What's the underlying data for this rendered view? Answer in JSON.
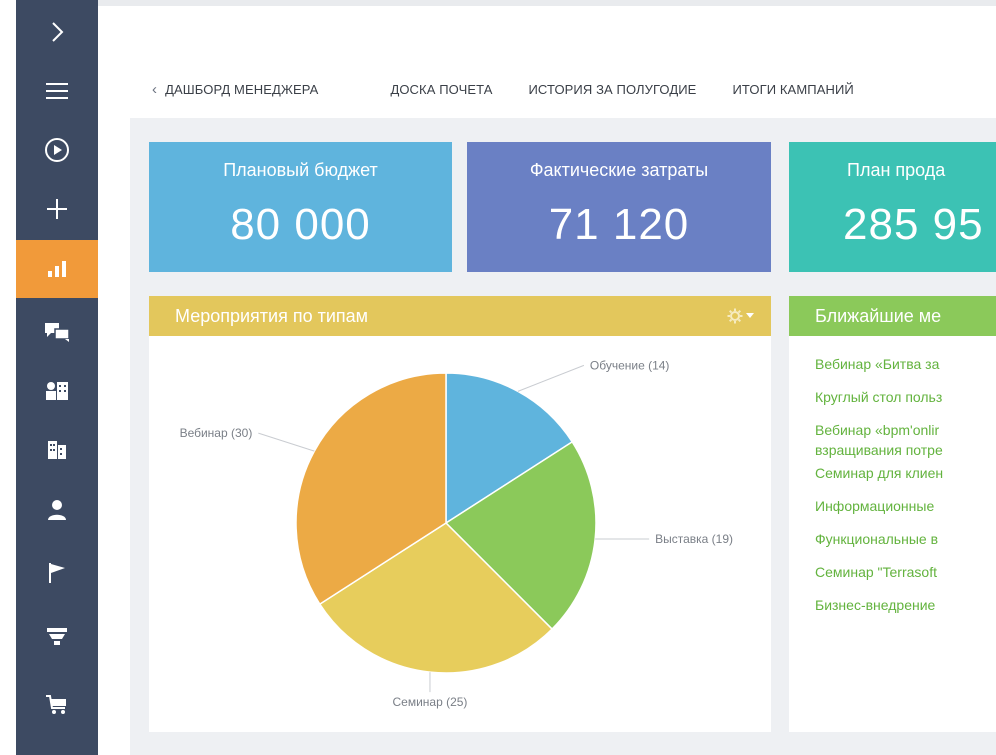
{
  "sidebar": {
    "items": [
      {
        "icon": "chevron-right-icon",
        "active": false
      },
      {
        "icon": "hamburger-menu-icon",
        "active": false
      },
      {
        "icon": "play-circle-icon",
        "active": false
      },
      {
        "icon": "plus-icon",
        "active": false
      },
      {
        "icon": "bar-chart-icon",
        "active": true
      },
      {
        "icon": "chat-bubbles-icon",
        "active": false
      },
      {
        "icon": "contacts-building-icon",
        "active": false
      },
      {
        "icon": "building-icon",
        "active": false
      },
      {
        "icon": "person-icon",
        "active": false
      },
      {
        "icon": "flag-icon",
        "active": false
      },
      {
        "icon": "funnel-icon",
        "active": false
      },
      {
        "icon": "cart-icon",
        "active": false
      }
    ]
  },
  "tabs": {
    "back_label": "ДАШБОРД МЕНЕДЖЕРА",
    "items": [
      "ДОСКА ПОЧЕТА",
      "ИСТОРИЯ ЗА ПОЛУГОДИЕ",
      "ИТОГИ КАМПАНИЙ"
    ]
  },
  "kpis": [
    {
      "title": "Плановый бюджет",
      "value": "80 000",
      "color": "#5fb4dd"
    },
    {
      "title": "Фактические затраты",
      "value": "71 120",
      "color": "#6a80c4"
    },
    {
      "title": "План прода",
      "value": "285 95",
      "color": "#3cc2b4"
    }
  ],
  "events_by_type": {
    "title": "Мероприятия по типам",
    "header_color": "#e3c75c",
    "settings_icon": "gear-icon"
  },
  "chart_data": {
    "type": "pie",
    "categories": [
      "Обучение",
      "Выставка",
      "Семинар",
      "Вебинар"
    ],
    "values": [
      14,
      19,
      25,
      30
    ],
    "labels": [
      "Обучение (14)",
      "Выставка (19)",
      "Семинар (25)",
      "Вебинар (30)"
    ],
    "colors": [
      "#5fb4dd",
      "#8bc95a",
      "#e7cd5c",
      "#ecaa45"
    ]
  },
  "upcoming": {
    "title": "Ближайшие ме",
    "header_color": "#8bc95a",
    "items": [
      {
        "lines": [
          "Вебинар «Битва за"
        ]
      },
      {
        "lines": [
          "Круглый стол польз"
        ]
      },
      {
        "lines": [
          "Вебинар «bpm'onlir",
          "взращивания потре"
        ]
      },
      {
        "lines": [
          "Семинар для клиен"
        ]
      },
      {
        "lines": [
          "Информационные"
        ]
      },
      {
        "lines": [
          "Функциональные в"
        ]
      },
      {
        "lines": [
          "Семинар \"Terrasoft"
        ]
      },
      {
        "lines": [
          "Бизнес-внедрение"
        ]
      }
    ]
  }
}
